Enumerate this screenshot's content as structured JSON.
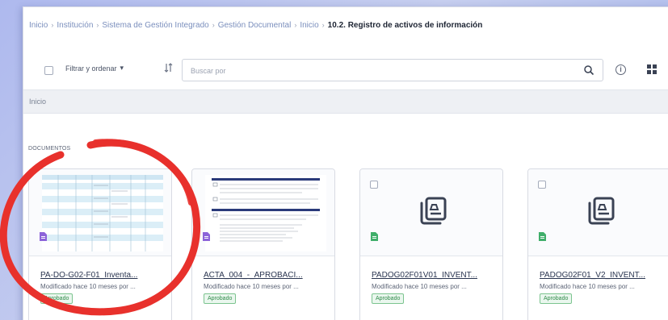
{
  "breadcrumb": {
    "items": [
      "Inicio",
      "Institución",
      "Sistema de Gestión Integrado",
      "Gestión Documental",
      "Inicio"
    ],
    "current": "10.2. Registro de activos de información",
    "separator": "›"
  },
  "toolbar": {
    "filter_label": "Filtrar y ordenar",
    "filter_caret": "▾",
    "sort_icon": "sort-icon",
    "search_placeholder": "Buscar por",
    "info_glyph": "i"
  },
  "section": {
    "title": "Inicio"
  },
  "documents_label": "DOCUMENTOS",
  "cards": [
    {
      "title": "PA-DO-G02-F01_Inventa...",
      "meta": "Modificado hace 10 meses por ...",
      "status": "Aprobado",
      "thumbnail": "spreadsheet-preview",
      "file_icon_color": "#8c63d9"
    },
    {
      "title": "ACTA_004_-_APROBACI...",
      "meta": "Modificado hace 10 meses por ...",
      "status": "Aprobado",
      "thumbnail": "document-preview",
      "file_icon_color": "#8c63d9"
    },
    {
      "title": "PADOG02F01V01_INVENT...",
      "meta": "Modificado hace 10 meses por ...",
      "status": "Aprobado",
      "thumbnail": "generic-file-icon",
      "file_icon_color": "#3fae6a"
    },
    {
      "title": "PADOG02F01_V2_INVENT...",
      "meta": "Modificado hace 10 meses por ...",
      "status": "Aprobado",
      "thumbnail": "generic-file-icon",
      "file_icon_color": "#3fae6a"
    }
  ],
  "colors": {
    "annotation_red": "#e8312c",
    "approved_green": "#2f8a49",
    "breadcrumb_link": "#7b8fbd"
  }
}
